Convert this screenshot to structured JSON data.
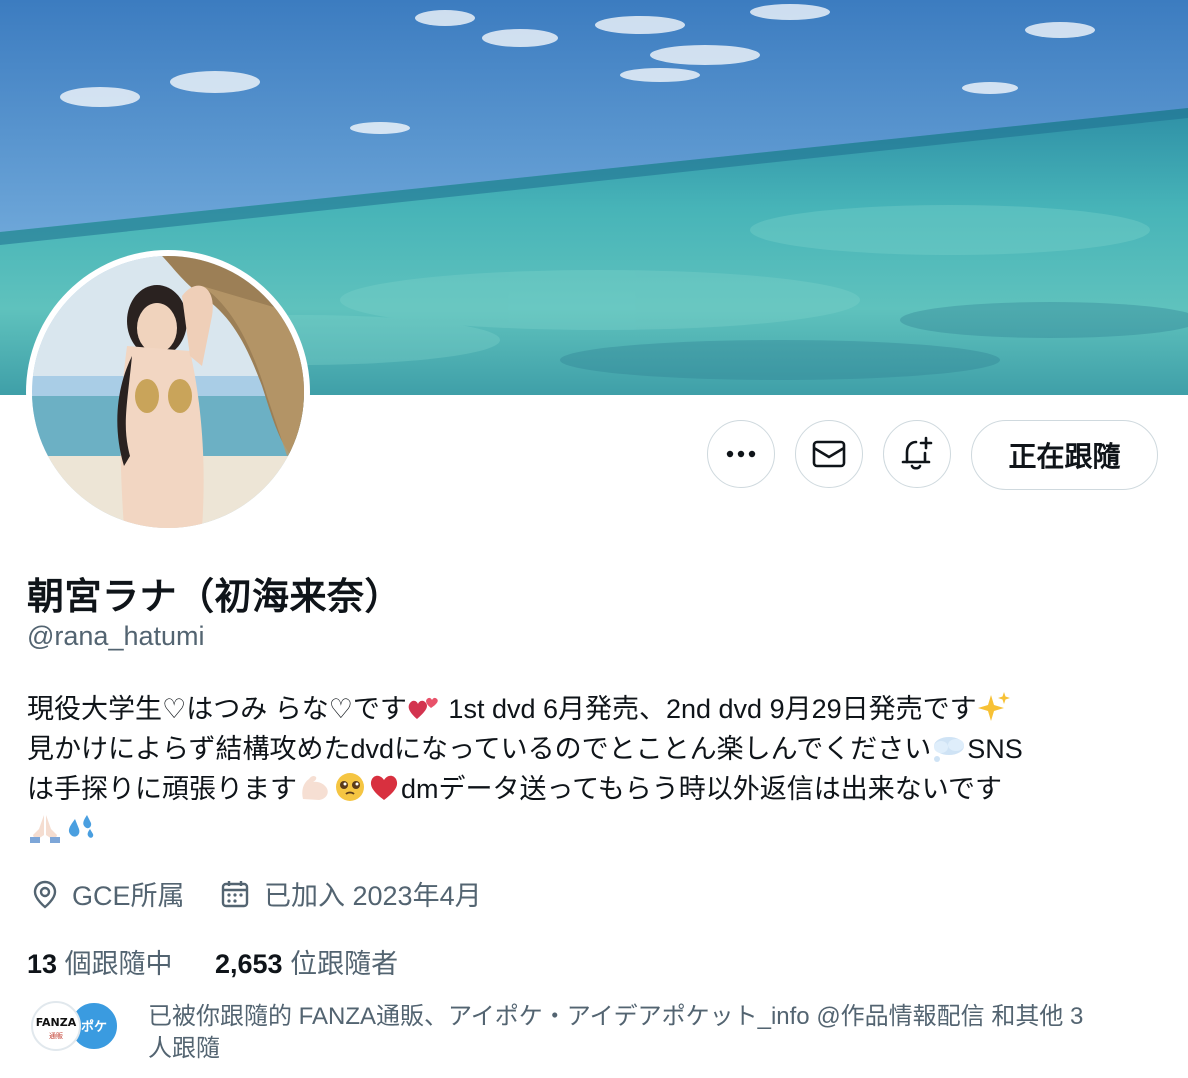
{
  "profile": {
    "display_name": "朝宮ラナ（初海来奈）",
    "handle": "@rana_hatumi"
  },
  "actions": {
    "more_icon": "more-horizontal-icon",
    "message_icon": "envelope-icon",
    "notify_icon": "bell-plus-icon",
    "follow_label": "正在跟隨"
  },
  "bio": {
    "line1_a": "現役大学生♡はつみ らな♡です",
    "line1_b": " 1st dvd 6月発売、2nd dvd 9月29日発売です",
    "line2_a": "見かけによらず結構攻めたdvdになっているのでとことん楽しんでください",
    "line2_b": "SNS",
    "line3_a": "は手探りに頑張ります",
    "line3_b": "dmデータ送ってもらう時以外返信は出来ないです",
    "emojis": [
      "two-hearts",
      "sparkles",
      "thought-balloon",
      "flexed-biceps",
      "pleading-face",
      "red-heart",
      "folded-hands",
      "sweat-droplets"
    ]
  },
  "meta": {
    "location": "GCE所属",
    "joined": "已加入 2023年4月"
  },
  "stats": {
    "following_count": "13",
    "following_label": "個跟隨中",
    "followers_count": "2,653",
    "followers_label": "位跟隨者"
  },
  "followed_by": {
    "line1": "已被你跟隨的 FANZA通販、アイポケ・アイデアポケット_info @作品情報配信 和其他 3",
    "line2": "人跟隨",
    "badge_text": "FANZA",
    "badge_sub": "通販",
    "badge2_text": "ポケ"
  },
  "colors": {
    "text_primary": "#0f1419",
    "text_secondary": "#536471",
    "border": "#cfd9de"
  }
}
